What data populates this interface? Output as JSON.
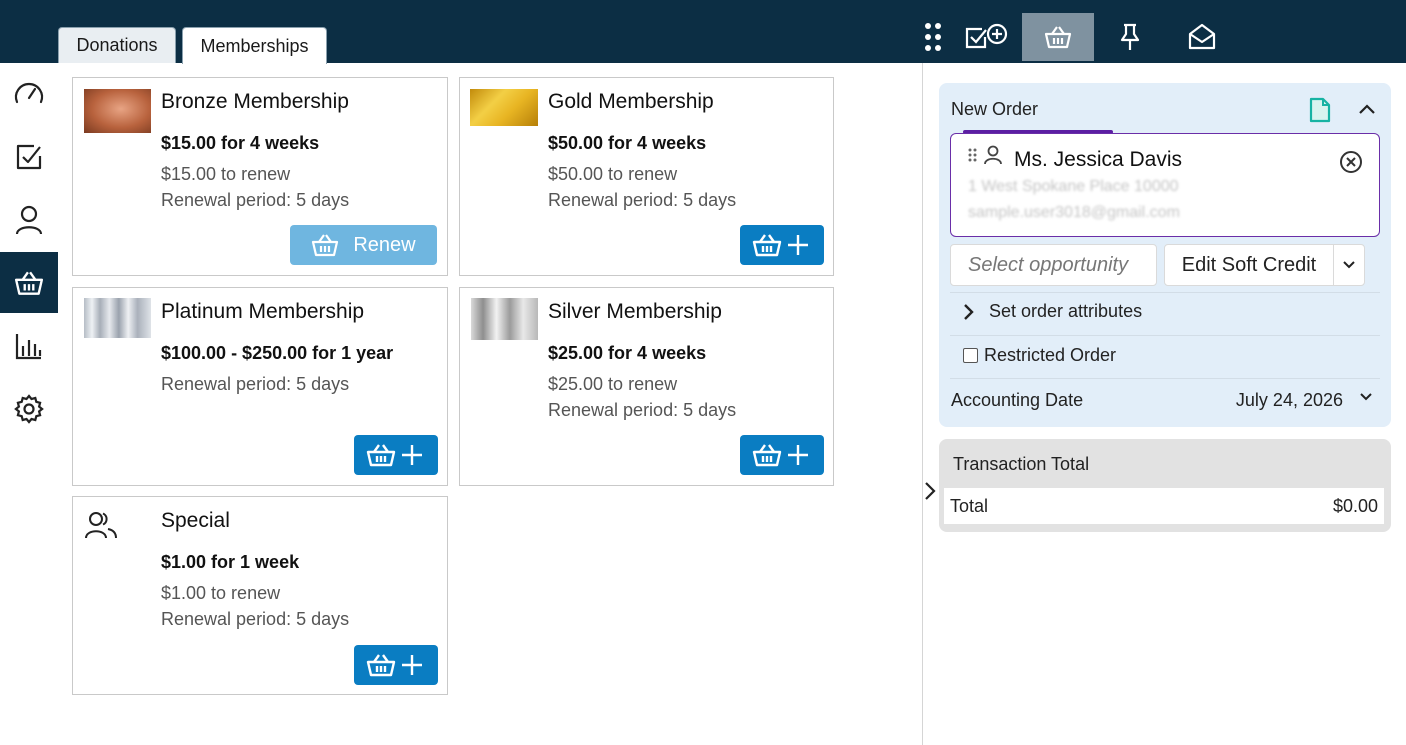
{
  "tabs": [
    {
      "label": "Donations"
    },
    {
      "label": "Memberships"
    }
  ],
  "top_icons": [
    "grid-dots-icon",
    "task-add-icon",
    "basket-icon",
    "pin-icon",
    "mail-open-icon"
  ],
  "sidebar": [
    "dashboard-gauge-icon",
    "checkbox-icon",
    "person-icon",
    "basket-icon",
    "bar-chart-icon",
    "gear-icon"
  ],
  "colors": {
    "topbar": "#0c2e44",
    "primary_button": "#0a7dc2",
    "renew_button": "#6fb6e0",
    "panel_bg": "#e2eef9",
    "accent": "#5b1ea3",
    "doc_icon": "#17b3a3"
  },
  "memberships": [
    {
      "name": "Bronze Membership",
      "price": "$15.00 for 4 weeks",
      "renew": "$15.00 to renew",
      "period": "Renewal period: 5 days",
      "action": "Renew"
    },
    {
      "name": "Gold Membership",
      "price": "$50.00 for 4 weeks",
      "renew": "$50.00 to renew",
      "period": "Renewal period: 5 days"
    },
    {
      "name": "Platinum Membership",
      "price": "$100.00 - $250.00 for 1 year",
      "period": "Renewal period: 5 days"
    },
    {
      "name": "Silver Membership",
      "price": "$25.00 for 4 weeks",
      "renew": "$25.00 to renew",
      "period": "Renewal period: 5 days"
    },
    {
      "name": "Special",
      "price": "$1.00 for 1 week",
      "renew": "$1.00 to renew",
      "period": "Renewal period: 5 days"
    }
  ],
  "order": {
    "title": "New Order",
    "contact_name": "Ms. Jessica Davis",
    "contact_address": "1 West Spokane Place 10000",
    "contact_email": "sample.user3018@gmail.com",
    "opportunity_placeholder": "Select opportunity",
    "soft_credit_label": "Edit Soft Credit",
    "attributes_label": "Set order attributes",
    "restricted_label": "Restricted Order",
    "restricted_checked": false,
    "accounting_label": "Accounting Date",
    "accounting_date": "July 24, 2026"
  },
  "transaction": {
    "title": "Transaction Total",
    "total_label": "Total",
    "total_value": "$0.00"
  }
}
